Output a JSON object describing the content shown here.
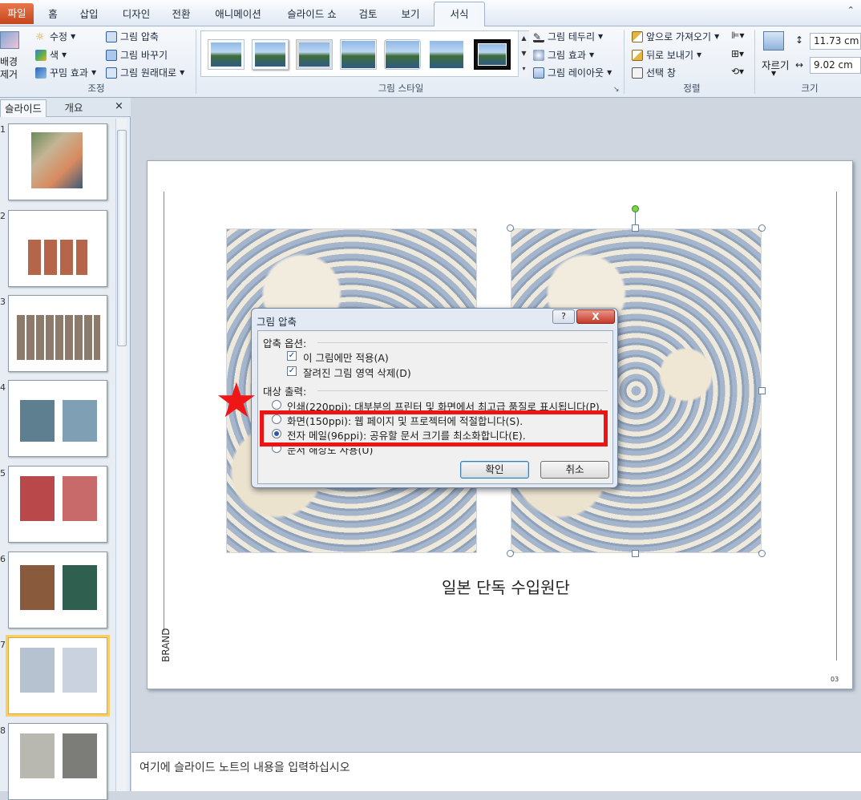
{
  "tabs": {
    "file": "파일",
    "items": [
      "홈",
      "삽입",
      "디자인",
      "전환",
      "애니메이션",
      "슬라이드 쇼",
      "검토",
      "보기"
    ],
    "active": "서식"
  },
  "ribbon": {
    "remove_bg_line1": "배경",
    "remove_bg_line2": "제거",
    "adjust": {
      "corrections": "수정",
      "color": "색",
      "artistic": "꾸밈 효과",
      "compress": "그림 압축",
      "change": "그림 바꾸기",
      "reset": "그림 원래대로",
      "label": "조정"
    },
    "styles": {
      "border": "그림 테두리",
      "effects": "그림 효과",
      "layout": "그림 레이아웃",
      "label": "그림 스타일"
    },
    "arrange": {
      "forward": "앞으로 가져오기",
      "backward": "뒤로 보내기",
      "pane": "선택 창",
      "label": "정렬"
    },
    "size": {
      "crop": "자르기",
      "height": "11.73 cm",
      "width": "9.02 cm",
      "label": "크기"
    }
  },
  "left_pane": {
    "tab_slides": "슬라이드",
    "tab_outline": "개요",
    "close": "×",
    "slide_numbers": [
      "1",
      "2",
      "3",
      "4",
      "5",
      "6",
      "7",
      "8"
    ]
  },
  "slide": {
    "caption": "일본 단독 수입원단",
    "side_label": "BRAND",
    "page_number": "03"
  },
  "dialog": {
    "title": "그림 압축",
    "help": "?",
    "close": "X",
    "options_header": "압축 옵션:",
    "opt_apply_only": "이 그림에만 적용(A)",
    "opt_delete_cropped": "잘려진 그림 영역 삭제(D)",
    "target_header": "대상 출력:",
    "target_print": "인쇄(220ppi): 대부분의 프린터 및 화면에서 최고급 품질로 표시됩니다(P).",
    "target_screen": "화면(150ppi): 웹 페이지 및 프로젝터에 적절합니다(S).",
    "target_email": "전자 메일(96ppi): 공유할 문서 크기를 최소화합니다(E).",
    "target_document": "문서 해상도 사용(U)",
    "ok": "확인",
    "cancel": "취소"
  },
  "notes": {
    "placeholder": "여기에 슬라이드 노트의 내용을 입력하십시오"
  },
  "colors": {
    "accent_red": "#ef1414",
    "file_tab": "#d6582c",
    "ribbon_bg": "#e4ebf4"
  }
}
